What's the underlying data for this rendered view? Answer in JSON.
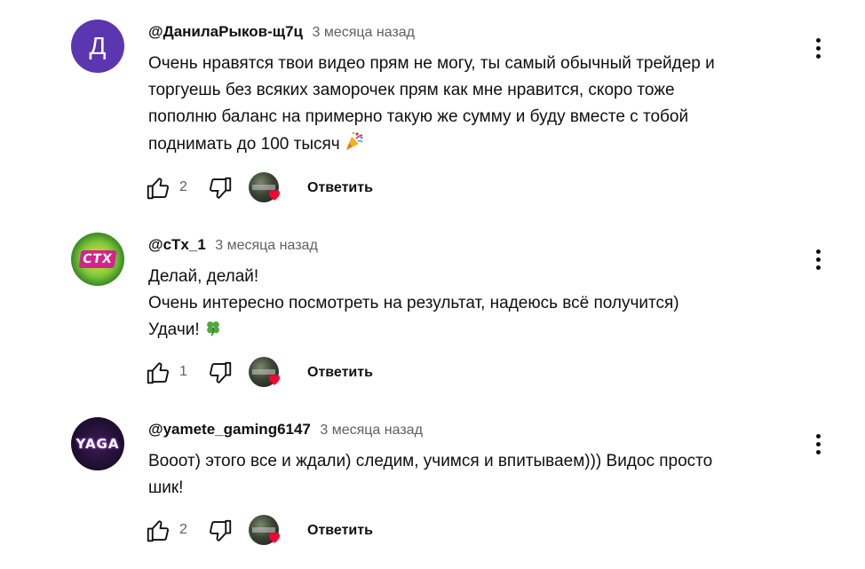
{
  "comments": [
    {
      "avatar_letter": "Д",
      "author": "@ДанилаРыков-щ7ц",
      "time": "3 месяца назад",
      "lines": [
        "Очень нравятся твои видео прям не могу, ты самый обычный трейдер и",
        "торгуешь без всяких заморочек прям как мне нравится, скоро тоже",
        "пополню баланс на примерно такую же сумму и буду вместе с тобой",
        "поднимать до 100 тысяч"
      ],
      "emoji": "party-popper-icon",
      "likes": "2",
      "reply_label": "Ответить"
    },
    {
      "avatar_text": "CTX",
      "author": "@cTx_1",
      "time": "3 месяца назад",
      "lines": [
        "Делай, делай!",
        "Очень интересно посмотреть на результат, надеюсь всё получится)",
        "Удачи!"
      ],
      "emoji": "four-leaf-clover-icon",
      "likes": "1",
      "reply_label": "Ответить"
    },
    {
      "avatar_text": "YAGA",
      "author": "@yamete_gaming6147",
      "time": "3 месяца назад",
      "lines": [
        "Вооот) этого все и ждали) следим, учимся и впитываем))) Видос просто",
        "шик!"
      ],
      "likes": "2",
      "reply_label": "Ответить"
    }
  ],
  "colors": {
    "text": "#0f0f0f",
    "secondary": "#606060",
    "heart": "#ff0033",
    "avatar_purple": "#5c35b0"
  }
}
